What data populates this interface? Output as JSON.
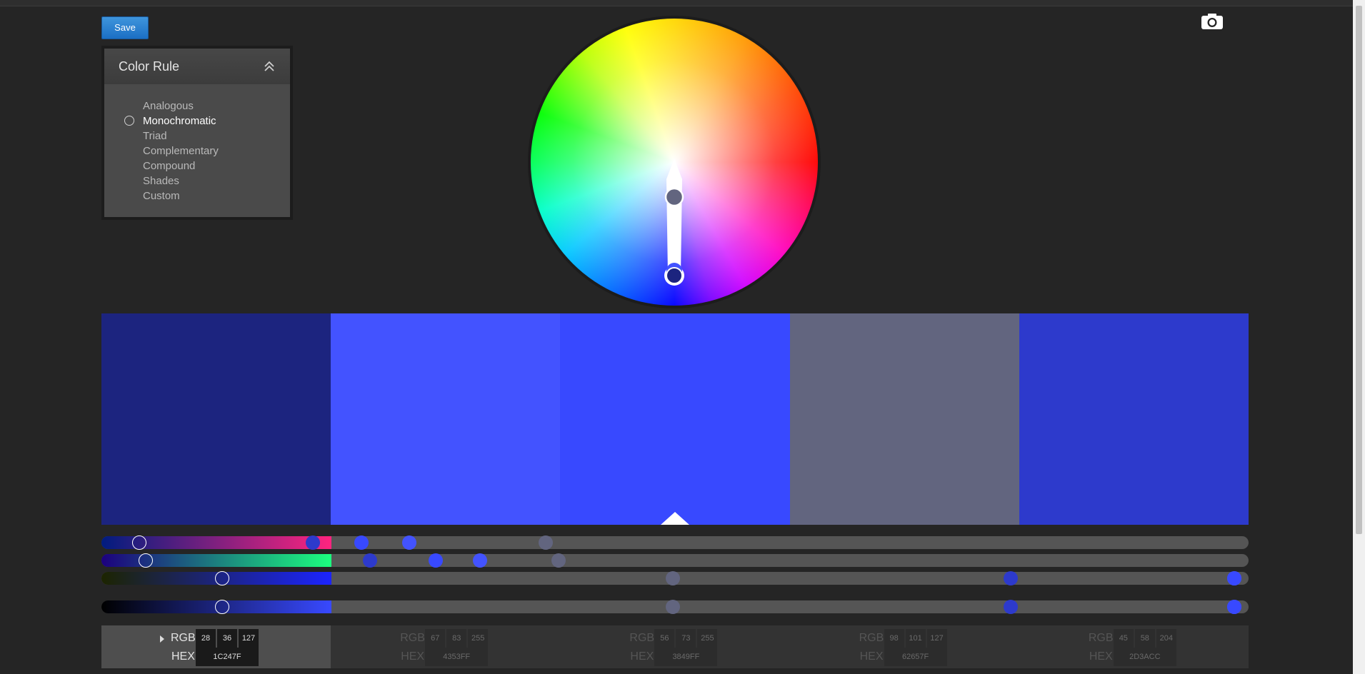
{
  "toolbar": {
    "save_label": "Save"
  },
  "color_rule": {
    "title": "Color Rule",
    "selected": "Monochromatic",
    "rules": [
      "Analogous",
      "Monochromatic",
      "Triad",
      "Complementary",
      "Compound",
      "Shades",
      "Custom"
    ]
  },
  "swatches": [
    {
      "hex": "1C247F",
      "r": "28",
      "g": "36",
      "b": "127",
      "color": "#1C247F"
    },
    {
      "hex": "4353FF",
      "r": "67",
      "g": "83",
      "b": "255",
      "color": "#4353FF"
    },
    {
      "hex": "3849FF",
      "r": "56",
      "g": "73",
      "b": "255",
      "color": "#3849FF"
    },
    {
      "hex": "62657F",
      "r": "98",
      "g": "101",
      "b": "127",
      "color": "#62657F"
    },
    {
      "hex": "2D3ACC",
      "r": "45",
      "g": "58",
      "b": "204",
      "color": "#2D3ACC"
    }
  ],
  "labels": {
    "rgb": "RGB",
    "hex": "HEX"
  },
  "active_swatch": 0,
  "base_swatch": 2
}
